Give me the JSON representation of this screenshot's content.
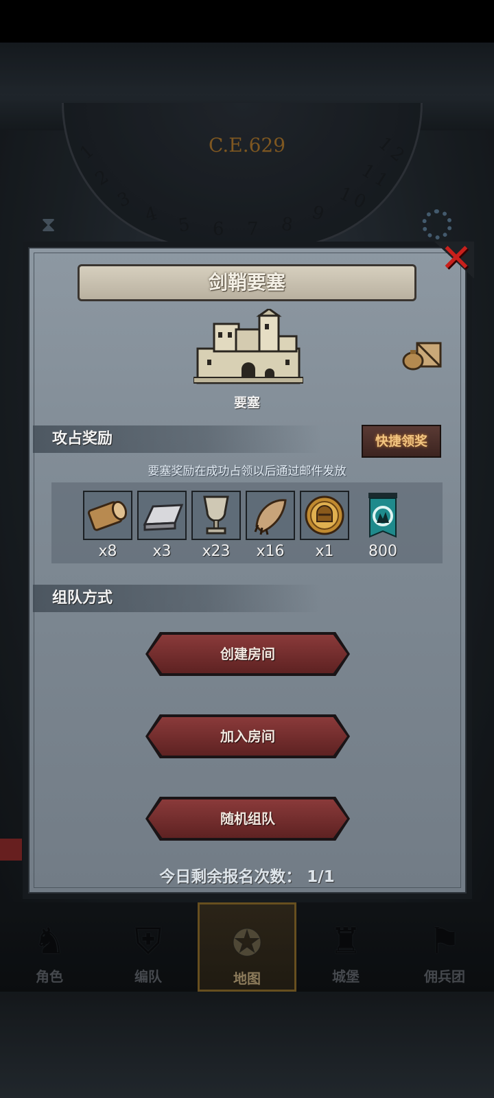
{
  "background": {
    "year": "C.E.629",
    "dial_numbers": [
      "1",
      "2",
      "3",
      "4",
      "5",
      "6",
      "7",
      "8",
      "9",
      "10",
      "11",
      "12"
    ]
  },
  "modal": {
    "title": "剑鞘要塞",
    "building_caption": "要塞",
    "capture_reward": {
      "header": "攻占奖励",
      "quick_claim_label": "快捷领奖",
      "note": "要塞奖励在成功占领以后通过邮件发放",
      "items": [
        {
          "icon": "wood-log-icon",
          "qty": "x8"
        },
        {
          "icon": "iron-ingot-icon",
          "qty": "x3"
        },
        {
          "icon": "goblet-icon",
          "qty": "x23"
        },
        {
          "icon": "fur-pelt-icon",
          "qty": "x16"
        },
        {
          "icon": "knight-helmet-medal-icon",
          "qty": "x1"
        },
        {
          "icon": "guild-banner-icon",
          "qty": "800"
        }
      ]
    },
    "team_mode": {
      "header": "组队方式",
      "create_room_label": "创建房间",
      "join_room_label": "加入房间",
      "random_team_label": "随机组队"
    },
    "remaining_text": "今日剩余报名次数： 1/1"
  },
  "bottom_nav": {
    "items": [
      {
        "label": "角色",
        "icon": "character-icon"
      },
      {
        "label": "编队",
        "icon": "formation-icon"
      },
      {
        "label": "地图",
        "icon": "map-compass-icon",
        "active": true
      },
      {
        "label": "城堡",
        "icon": "castle-icon"
      },
      {
        "label": "佣兵团",
        "icon": "mercenary-icon"
      }
    ]
  },
  "colors": {
    "accent_red": "#c8201c",
    "button_red": "#7a3030",
    "gold": "#f1c480"
  }
}
